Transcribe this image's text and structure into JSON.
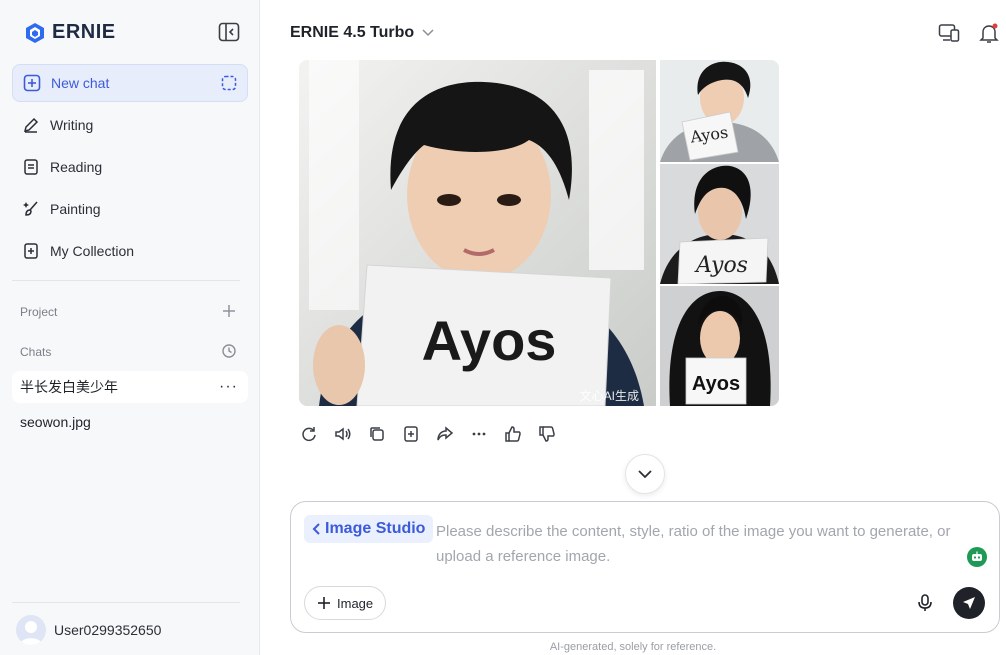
{
  "app": {
    "name": "ERNIE",
    "brand_color": "#2f6bf0"
  },
  "sidebar": {
    "nav": [
      {
        "label": "New chat",
        "icon": "plus-square-icon",
        "active": true
      },
      {
        "label": "Writing",
        "icon": "pen-icon"
      },
      {
        "label": "Reading",
        "icon": "book-icon"
      },
      {
        "label": "Painting",
        "icon": "brush-icon"
      },
      {
        "label": "My Collection",
        "icon": "bookmark-icon"
      }
    ],
    "project_label": "Project",
    "chats_label": "Chats",
    "chats": [
      {
        "title": "半长发白美少年",
        "active": true,
        "more": "···"
      },
      {
        "title": "seowon.jpg"
      }
    ],
    "user": {
      "name": "User0299352650"
    }
  },
  "header": {
    "model": "ERNIE 4.5 Turbo"
  },
  "gallery": {
    "main_sign": "Ayos",
    "side_signs": [
      "Ayos",
      "Ayos",
      "Ayos"
    ],
    "watermark": "文心AI生成"
  },
  "composer": {
    "mode_chip": "Image Studio",
    "placeholder": "Please describe the content, style, ratio of the image you want to generate, or upload a reference image.",
    "image_button": "Image"
  },
  "footer": {
    "disclaimer": "AI-generated, solely for reference."
  }
}
